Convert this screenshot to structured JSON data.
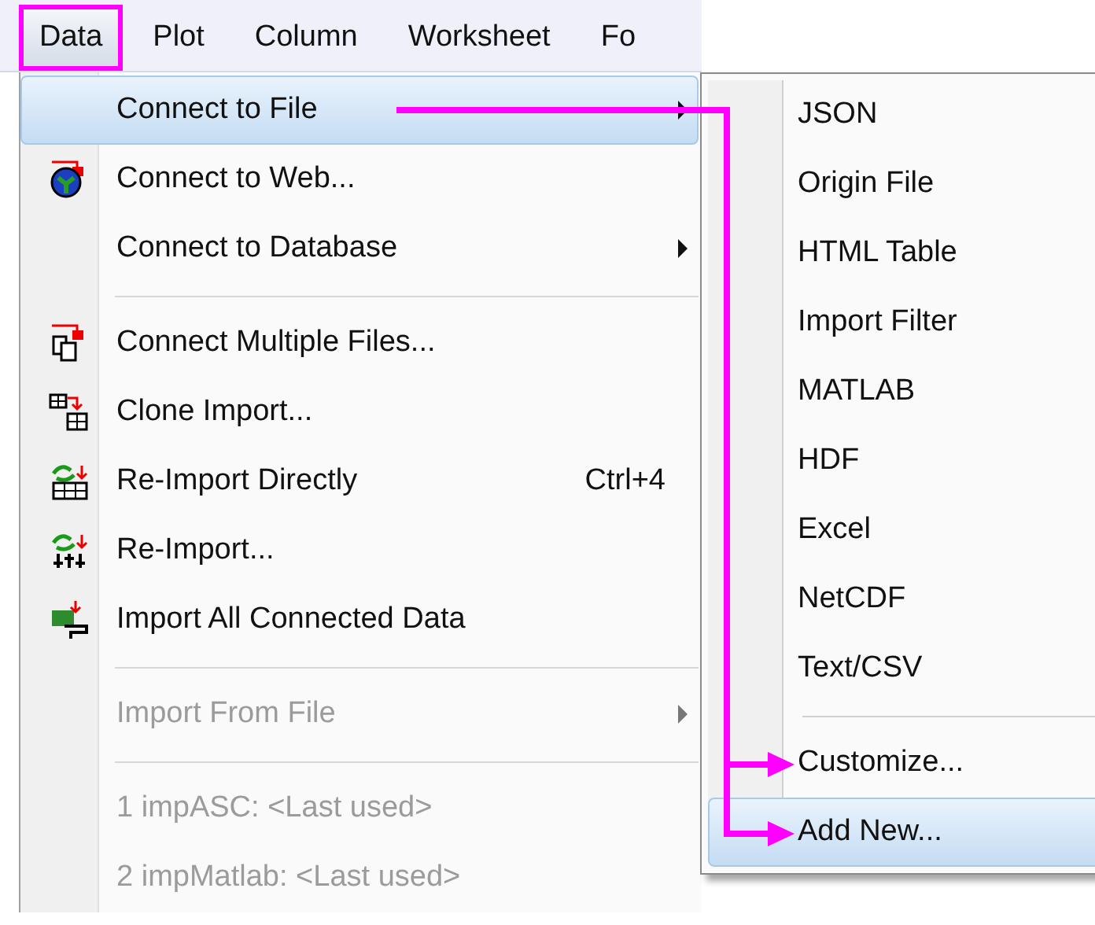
{
  "menubar": [
    {
      "label": "Data",
      "selected": true
    },
    {
      "label": "Plot",
      "selected": false
    },
    {
      "label": "Column",
      "selected": false
    },
    {
      "label": "Worksheet",
      "selected": false
    },
    {
      "label": "Fo",
      "selected": false
    }
  ],
  "menu": [
    {
      "kind": "item",
      "label": "Connect to File",
      "submenu": true,
      "selected": true,
      "disabled": false
    },
    {
      "kind": "item",
      "label": "Connect to Web...",
      "submenu": false,
      "selected": false,
      "disabled": false
    },
    {
      "kind": "item",
      "label": "Connect to Database",
      "submenu": true,
      "selected": false,
      "disabled": false
    },
    {
      "kind": "separator"
    },
    {
      "kind": "item",
      "label": "Connect Multiple Files...",
      "submenu": false,
      "selected": false,
      "disabled": false
    },
    {
      "kind": "item",
      "label": "Clone Import...",
      "submenu": false,
      "selected": false,
      "disabled": false
    },
    {
      "kind": "item",
      "label": "Re-Import Directly",
      "shortcut": "Ctrl+4",
      "submenu": false,
      "selected": false,
      "disabled": false
    },
    {
      "kind": "item",
      "label": "Re-Import...",
      "submenu": false,
      "selected": false,
      "disabled": false
    },
    {
      "kind": "item",
      "label": "Import All Connected Data",
      "submenu": false,
      "selected": false,
      "disabled": false
    },
    {
      "kind": "separator"
    },
    {
      "kind": "item",
      "label": "Import From File",
      "submenu": true,
      "selected": false,
      "disabled": true
    },
    {
      "kind": "separator"
    },
    {
      "kind": "item",
      "label": "1 impASC: <Last used>",
      "submenu": false,
      "selected": false,
      "disabled": true
    },
    {
      "kind": "item",
      "label": "2 impMatlab: <Last used>",
      "submenu": false,
      "selected": false,
      "disabled": true
    }
  ],
  "submenu": [
    {
      "kind": "item",
      "label": "JSON",
      "selected": false
    },
    {
      "kind": "item",
      "label": "Origin File",
      "selected": false
    },
    {
      "kind": "item",
      "label": "HTML Table",
      "selected": false
    },
    {
      "kind": "item",
      "label": "Import Filter",
      "selected": false
    },
    {
      "kind": "item",
      "label": "MATLAB",
      "selected": false
    },
    {
      "kind": "item",
      "label": "HDF",
      "selected": false
    },
    {
      "kind": "item",
      "label": "Excel",
      "selected": false
    },
    {
      "kind": "item",
      "label": "NetCDF",
      "selected": false
    },
    {
      "kind": "item",
      "label": "Text/CSV",
      "selected": false
    },
    {
      "kind": "separator"
    },
    {
      "kind": "item",
      "label": "Customize...",
      "selected": false
    },
    {
      "kind": "item",
      "label": "Add New...",
      "selected": true
    }
  ]
}
